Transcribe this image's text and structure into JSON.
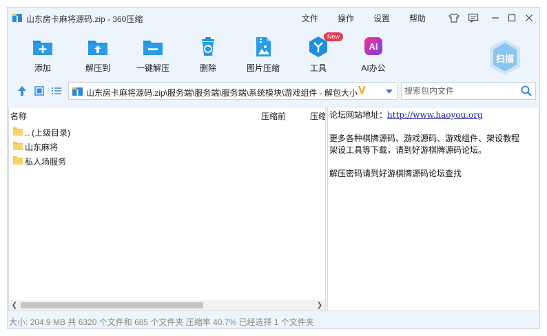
{
  "window": {
    "title": "山东房卡麻将源码.zip - 360压缩",
    "menus": [
      "文件",
      "操作",
      "设置",
      "帮助"
    ]
  },
  "toolbar": {
    "items": [
      {
        "label": "添加",
        "icon": "add-icon"
      },
      {
        "label": "解压到",
        "icon": "extract-to-icon"
      },
      {
        "label": "一键解压",
        "icon": "one-click-extract-icon"
      },
      {
        "label": "删除",
        "icon": "delete-icon"
      },
      {
        "label": "图片压缩",
        "icon": "image-compress-icon"
      },
      {
        "label": "工具",
        "icon": "tools-icon",
        "badge": "New"
      },
      {
        "label": "AI办公",
        "icon": "ai-office-icon",
        "glyph": "AI"
      }
    ],
    "scan_label": "扫描"
  },
  "address": {
    "path": "山东房卡麻将源码.zip\\服务端\\服务端\\服务端\\系统模块\\游戏组件 - 解包大小",
    "v_mark": "V"
  },
  "search": {
    "placeholder": "搜索包内文件"
  },
  "filelist": {
    "columns": [
      "名称",
      "压缩前",
      "压缩"
    ],
    "rows": [
      {
        "name": ".. (上级目录)"
      },
      {
        "name": "山东麻将"
      },
      {
        "name": "私人场服务"
      }
    ]
  },
  "info": {
    "forum_label": "论坛网站地址：",
    "forum_url": "http://www.haoyou.org",
    "line2": "更多各种棋牌源码、游戏源码、游戏组件、架设教程",
    "line3": "架设工具等下载，请到好游棋牌源码论坛。",
    "line4": "解压密码请到好游棋牌源码论坛查找"
  },
  "status": {
    "text": "大小: 204.9 MB 共 6320 个文件和 685 个文件夹 压缩率 40.7% 已经选择 1 个文件夹"
  },
  "colors": {
    "accent": "#1e8fd8",
    "window_bg": "#eef4fb",
    "folder": "#f5c342",
    "link": "#1a1aa8",
    "badge": "#e8384f",
    "ai_gradient_start": "#f0328c",
    "ai_gradient_end": "#7b3cf0"
  }
}
